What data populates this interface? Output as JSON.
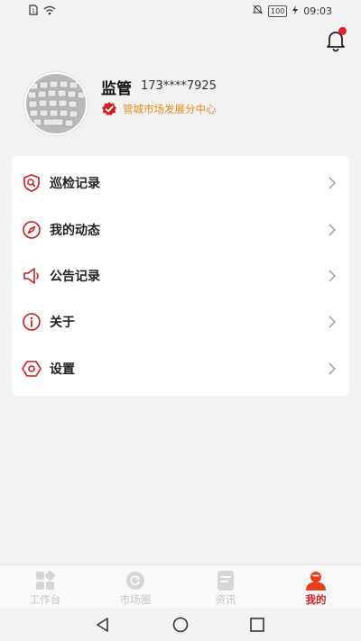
{
  "status_bar": {
    "battery": "100",
    "time": "09:03"
  },
  "profile": {
    "name": "监管",
    "phone": "173****7925",
    "org": "管城市场发展分中心"
  },
  "menu": [
    {
      "label": "巡检记录",
      "icon": "search-shield-icon"
    },
    {
      "label": "我的动态",
      "icon": "compass-icon"
    },
    {
      "label": "公告记录",
      "icon": "megaphone-icon"
    },
    {
      "label": "关于",
      "icon": "info-icon"
    },
    {
      "label": "设置",
      "icon": "settings-hexagon-icon"
    }
  ],
  "tabs": [
    {
      "label": "工作台",
      "icon": "dashboard-icon",
      "active": false
    },
    {
      "label": "市场圈",
      "icon": "refresh-circle-icon",
      "active": false
    },
    {
      "label": "资讯",
      "icon": "document-icon",
      "active": false
    },
    {
      "label": "我的",
      "icon": "user-icon",
      "active": true
    }
  ],
  "colors": {
    "accent": "#d11f1f",
    "org_text": "#e68a1f",
    "inactive_tab": "#c2c2c2",
    "background": "#f2f2f2"
  }
}
